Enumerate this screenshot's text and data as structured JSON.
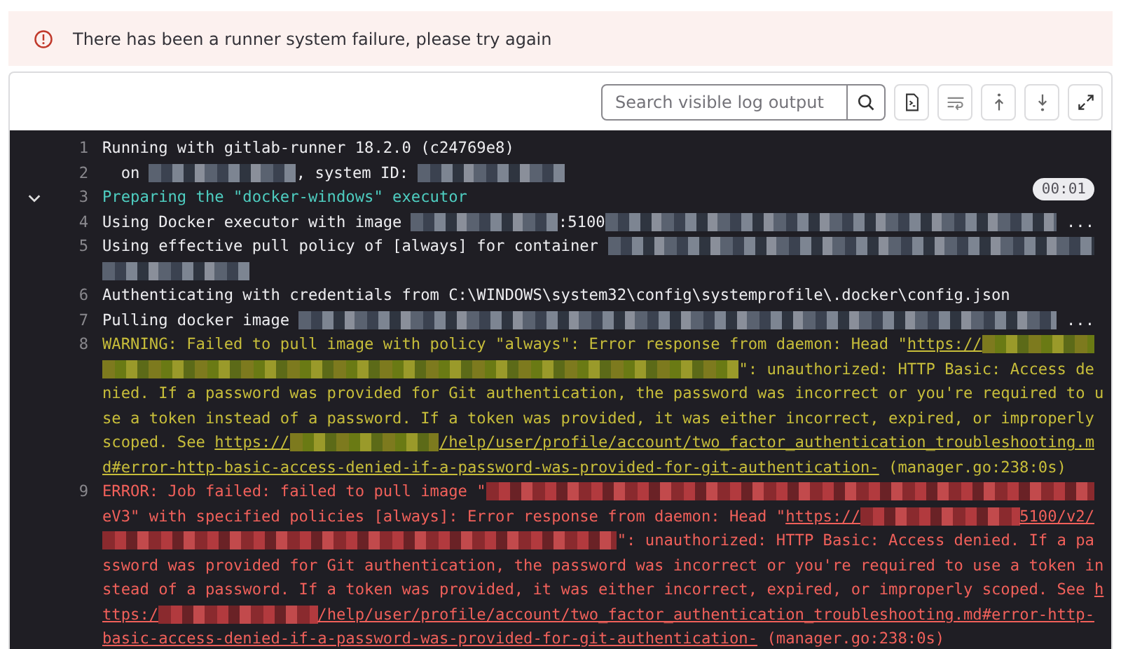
{
  "alert": {
    "message": "There has been a runner system failure, please try again"
  },
  "toolbar": {
    "search": {
      "placeholder": "Search visible log output"
    }
  },
  "log": [
    {
      "number": "1",
      "kind": "plain",
      "rows": [
        {
          "segments": [
            {
              "kind": "text",
              "text": "Running with gitlab-runner 18.2.0 (c24769e8)"
            }
          ]
        }
      ]
    },
    {
      "number": "2",
      "kind": "plain",
      "rows": [
        {
          "segments": [
            {
              "kind": "text",
              "text": "  on "
            },
            {
              "kind": "blot"
            },
            {
              "kind": "text",
              "text": ", system ID: "
            },
            {
              "kind": "blot"
            }
          ]
        }
      ]
    },
    {
      "number": "3",
      "kind": "section",
      "expanded": true,
      "duration": "00:01",
      "rows": [
        {
          "segments": [
            {
              "kind": "text",
              "text": "Preparing the \"docker-windows\" executor"
            }
          ]
        }
      ]
    },
    {
      "number": "4",
      "kind": "plain",
      "rows": [
        {
          "segments": [
            {
              "kind": "text",
              "text": "Using Docker executor with image "
            },
            {
              "kind": "blot"
            },
            {
              "kind": "text",
              "text": ":5100"
            },
            {
              "kind": "band"
            },
            {
              "kind": "text",
              "text": " ..."
            }
          ]
        }
      ]
    },
    {
      "number": "5",
      "kind": "plain",
      "rows": [
        {
          "segments": [
            {
              "kind": "text",
              "text": "Using effective pull policy of [always] for container "
            },
            {
              "kind": "band"
            }
          ]
        },
        {
          "segments": [
            {
              "kind": "blot"
            }
          ]
        }
      ]
    },
    {
      "number": "6",
      "kind": "plain",
      "rows": [
        {
          "segments": [
            {
              "kind": "text",
              "text": "Authenticating with credentials from C:\\WINDOWS\\system32\\config\\systemprofile\\.docker\\config.json"
            }
          ]
        }
      ]
    },
    {
      "number": "7",
      "kind": "plain",
      "rows": [
        {
          "segments": [
            {
              "kind": "text",
              "text": "Pulling docker image "
            },
            {
              "kind": "band"
            },
            {
              "kind": "text",
              "text": " ..."
            }
          ]
        }
      ]
    },
    {
      "number": "8",
      "kind": "warning",
      "rows": [
        {
          "segments": [
            {
              "kind": "text",
              "text": "WARNING: Failed to pull image with policy \"always\": Error response from daemon: Head \""
            },
            {
              "kind": "link",
              "text": "https://"
            },
            {
              "kind": "band"
            }
          ]
        },
        {
          "segments": [
            {
              "kind": "band"
            },
            {
              "kind": "text",
              "text": "\": unauthorized: HTTP Basic: Access de"
            }
          ]
        },
        {
          "segments": [
            {
              "kind": "text",
              "text": "nied. If a password was provided for Git authentication, the password was incorrect or you're required to u"
            }
          ]
        },
        {
          "segments": [
            {
              "kind": "text",
              "text": "se a token instead of a password. If a token was provided, it was either incorrect, expired, or improperly"
            }
          ]
        },
        {
          "segments": [
            {
              "kind": "text",
              "text": "scoped. See "
            },
            {
              "kind": "link",
              "text": "https://"
            },
            {
              "kind": "band"
            },
            {
              "kind": "link",
              "text": "/help/user/profile/account/two_factor_authentication_troubleshooting.m"
            }
          ]
        },
        {
          "segments": [
            {
              "kind": "link",
              "text": "d#error-http-basic-access-denied-if-a-password-was-provided-for-git-authentication-"
            },
            {
              "kind": "text",
              "text": " (manager.go:238:0s)"
            }
          ]
        }
      ]
    },
    {
      "number": "9",
      "kind": "error",
      "rows": [
        {
          "segments": [
            {
              "kind": "text",
              "text": "ERROR: Job failed: failed to pull image \""
            },
            {
              "kind": "band"
            }
          ]
        },
        {
          "segments": [
            {
              "kind": "text",
              "text": "eV3\" with specified policies [always]: Error response from daemon: Head \""
            },
            {
              "kind": "link",
              "text": "https://"
            },
            {
              "kind": "band"
            },
            {
              "kind": "link",
              "text": "5100/v2/"
            }
          ]
        },
        {
          "segments": [
            {
              "kind": "band"
            },
            {
              "kind": "text",
              "text": "\": unauthorized: HTTP Basic: Access denied. If a pa"
            }
          ]
        },
        {
          "segments": [
            {
              "kind": "text",
              "text": "ssword was provided for Git authentication, the password was incorrect or you're required to use a token in"
            }
          ]
        },
        {
          "segments": [
            {
              "kind": "text",
              "text": "stead of a password. If a token was provided, it was either incorrect, expired, or improperly scoped. See "
            },
            {
              "kind": "link",
              "text": "h"
            }
          ]
        },
        {
          "segments": [
            {
              "kind": "link",
              "text": "ttps:/"
            },
            {
              "kind": "band"
            },
            {
              "kind": "link",
              "text": "/help/user/profile/account/two_factor_authentication_troubleshooting.md#error-http-"
            }
          ]
        },
        {
          "segments": [
            {
              "kind": "link",
              "text": "basic-access-denied-if-a-password-was-provided-for-git-authentication-"
            },
            {
              "kind": "text",
              "text": " (manager.go:238:0s)"
            }
          ]
        }
      ]
    }
  ]
}
